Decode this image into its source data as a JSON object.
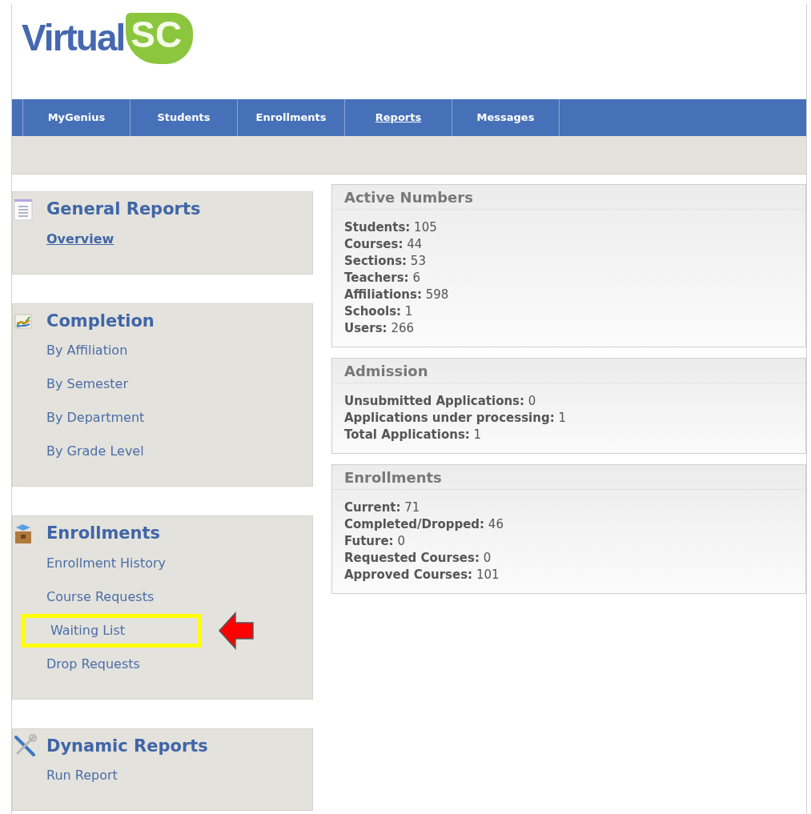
{
  "logo": {
    "text": "Virtual",
    "accent": "SC"
  },
  "nav": [
    {
      "label": "MyGenius",
      "selected": false
    },
    {
      "label": "Students",
      "selected": false
    },
    {
      "label": "Enrollments",
      "selected": false
    },
    {
      "label": "Reports",
      "selected": true
    },
    {
      "label": "Messages",
      "selected": false
    }
  ],
  "sidebar": [
    {
      "title": "General Reports",
      "items": [
        {
          "label": "Overview",
          "selected": true,
          "highlighted": false
        }
      ]
    },
    {
      "title": "Completion",
      "items": [
        {
          "label": "By Affiliation",
          "selected": false,
          "highlighted": false
        },
        {
          "label": "By Semester",
          "selected": false,
          "highlighted": false
        },
        {
          "label": "By Department",
          "selected": false,
          "highlighted": false
        },
        {
          "label": "By Grade Level",
          "selected": false,
          "highlighted": false
        }
      ]
    },
    {
      "title": "Enrollments",
      "items": [
        {
          "label": "Enrollment History",
          "selected": false,
          "highlighted": false
        },
        {
          "label": "Course Requests",
          "selected": false,
          "highlighted": false
        },
        {
          "label": "Waiting List",
          "selected": false,
          "highlighted": true
        },
        {
          "label": "Drop Requests",
          "selected": false,
          "highlighted": false
        }
      ]
    },
    {
      "title": "Dynamic Reports",
      "items": [
        {
          "label": "Run Report",
          "selected": false,
          "highlighted": false
        }
      ]
    }
  ],
  "panels": [
    {
      "title": "Active Numbers",
      "lines": [
        "**Students:** 105",
        "**Courses:** 44",
        "**Sections:** 53",
        "**Teachers:** 6",
        "**Affiliations:** 598",
        "**Schools:** 1",
        "**Users:** 266"
      ]
    },
    {
      "title": "Admission",
      "lines": [
        "**Unsubmitted Applications:** 0",
        "**Applications under processing:** 1",
        "**Total Applications:** 1"
      ]
    },
    {
      "title": "Enrollments",
      "lines": [
        "**Current:** 71",
        "**Completed/Dropped:** 46",
        "**Future:** 0",
        "**Requested Courses:** 0",
        "**Approved Courses:** 101"
      ]
    }
  ]
}
